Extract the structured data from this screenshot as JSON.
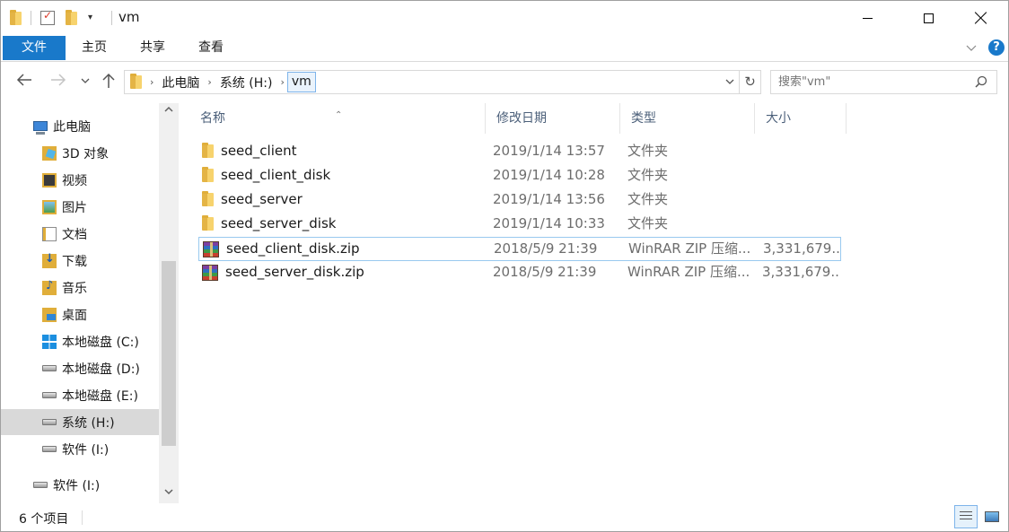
{
  "window": {
    "title": "vm"
  },
  "ribbon": {
    "tabs": [
      {
        "label": "文件",
        "active": true
      },
      {
        "label": "主页"
      },
      {
        "label": "共享"
      },
      {
        "label": "查看"
      }
    ]
  },
  "address": {
    "segments": [
      "此电脑",
      "系统 (H:)",
      "vm"
    ]
  },
  "search": {
    "placeholder": "搜索\"vm\""
  },
  "sidebar": {
    "items": [
      {
        "label": "此电脑",
        "icon": "computer-icon"
      },
      {
        "label": "3D 对象",
        "icon": "3d-objects-icon"
      },
      {
        "label": "视频",
        "icon": "videos-icon"
      },
      {
        "label": "图片",
        "icon": "pictures-icon"
      },
      {
        "label": "文档",
        "icon": "documents-icon"
      },
      {
        "label": "下载",
        "icon": "downloads-icon"
      },
      {
        "label": "音乐",
        "icon": "music-icon"
      },
      {
        "label": "桌面",
        "icon": "desktop-icon"
      },
      {
        "label": "本地磁盘 (C:)",
        "icon": "windows-drive-icon"
      },
      {
        "label": "本地磁盘 (D:)",
        "icon": "drive-icon"
      },
      {
        "label": "本地磁盘 (E:)",
        "icon": "drive-icon"
      },
      {
        "label": "系统 (H:)",
        "icon": "drive-icon",
        "selected": true
      },
      {
        "label": "软件 (I:)",
        "icon": "drive-icon"
      },
      {
        "label": "软件 (I:)",
        "icon": "drive-icon"
      }
    ]
  },
  "columns": {
    "name": "名称",
    "date": "修改日期",
    "type": "类型",
    "size": "大小"
  },
  "files": [
    {
      "name": "seed_client",
      "date": "2019/1/14 13:57",
      "type": "文件夹",
      "size": "",
      "icon": "folder-icon"
    },
    {
      "name": "seed_client_disk",
      "date": "2019/1/14 10:28",
      "type": "文件夹",
      "size": "",
      "icon": "folder-icon"
    },
    {
      "name": "seed_server",
      "date": "2019/1/14 13:56",
      "type": "文件夹",
      "size": "",
      "icon": "folder-icon"
    },
    {
      "name": "seed_server_disk",
      "date": "2019/1/14 10:33",
      "type": "文件夹",
      "size": "",
      "icon": "folder-icon"
    },
    {
      "name": "seed_client_disk.zip",
      "date": "2018/5/9 21:39",
      "type": "WinRAR ZIP 压缩...",
      "size": "3,331,679...",
      "icon": "winrar-zip-icon",
      "hover": true
    },
    {
      "name": "seed_server_disk.zip",
      "date": "2018/5/9 21:39",
      "type": "WinRAR ZIP 压缩...",
      "size": "3,331,679...",
      "icon": "winrar-zip-icon"
    }
  ],
  "status": {
    "item_count": "6 个项目"
  },
  "colors": {
    "accent": "#1979ca",
    "selection": "#d9d9d9",
    "header_text": "#4c607a"
  }
}
